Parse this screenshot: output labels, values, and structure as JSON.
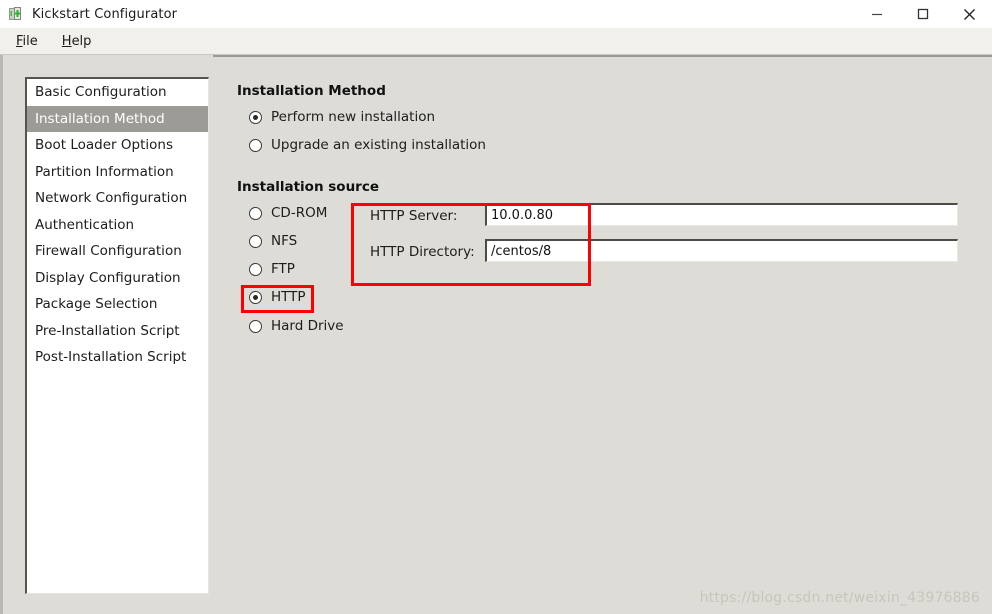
{
  "window": {
    "title": "Kickstart Configurator",
    "app_icon": "kickstart-icon",
    "controls": {
      "minimize": "minimize-icon",
      "maximize": "maximize-icon",
      "close": "close-icon"
    }
  },
  "menubar": {
    "items": [
      {
        "label": "File",
        "mnemonic": "F"
      },
      {
        "label": "Help",
        "mnemonic": "H"
      }
    ]
  },
  "sidebar": {
    "items": [
      {
        "label": "Basic Configuration",
        "selected": false
      },
      {
        "label": "Installation Method",
        "selected": true
      },
      {
        "label": "Boot Loader Options",
        "selected": false
      },
      {
        "label": "Partition Information",
        "selected": false
      },
      {
        "label": "Network Configuration",
        "selected": false
      },
      {
        "label": "Authentication",
        "selected": false
      },
      {
        "label": "Firewall Configuration",
        "selected": false
      },
      {
        "label": "Display Configuration",
        "selected": false
      },
      {
        "label": "Package Selection",
        "selected": false
      },
      {
        "label": "Pre-Installation Script",
        "selected": false
      },
      {
        "label": "Post-Installation Script",
        "selected": false
      }
    ]
  },
  "main": {
    "installation_method": {
      "heading": "Installation Method",
      "options": [
        {
          "label": "Perform new installation",
          "selected": true
        },
        {
          "label": "Upgrade an existing installation",
          "selected": false
        }
      ]
    },
    "installation_source": {
      "heading": "Installation source",
      "options": [
        {
          "label": "CD-ROM",
          "selected": false
        },
        {
          "label": "NFS",
          "selected": false
        },
        {
          "label": "FTP",
          "selected": false
        },
        {
          "label": "HTTP",
          "selected": true
        },
        {
          "label": "Hard Drive",
          "selected": false
        }
      ],
      "fields": [
        {
          "label": "HTTP Server:",
          "value": "10.0.0.80"
        },
        {
          "label": "HTTP Directory:",
          "value": "/centos/8"
        }
      ]
    }
  },
  "annotations": {
    "highlight_color": "#ff0000",
    "boxes": [
      "http-radio-highlight",
      "http-fields-highlight"
    ]
  },
  "watermark": {
    "text": "https://blog.csdn.net/weixin_43976886"
  }
}
